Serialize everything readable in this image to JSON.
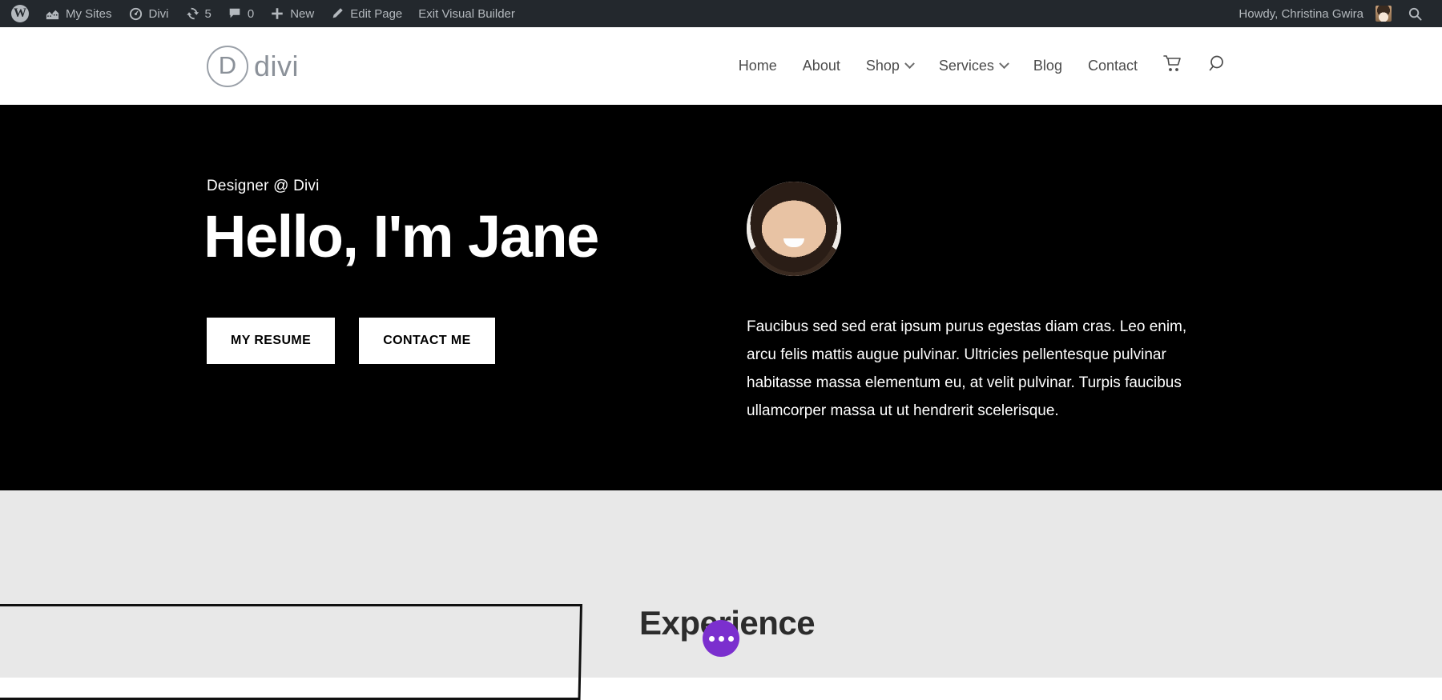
{
  "adminbar": {
    "wp_logo": "wordpress-logo-icon",
    "items": [
      {
        "label": "My Sites",
        "icon": "sites-icon"
      },
      {
        "label": "Divi",
        "icon": "divi-speedometer-icon"
      },
      {
        "label": "5",
        "icon": "updates-icon"
      },
      {
        "label": "0",
        "icon": "comments-icon"
      },
      {
        "label": "New",
        "icon": "plus-icon"
      },
      {
        "label": "Edit Page",
        "icon": "pencil-icon"
      },
      {
        "label": "Exit Visual Builder",
        "icon": "none"
      }
    ],
    "howdy": "Howdy, Christina Gwira",
    "search_icon": "search-icon"
  },
  "header": {
    "logo_letter": "D",
    "logo_word": "divi",
    "nav": [
      {
        "label": "Home",
        "has_caret": false
      },
      {
        "label": "About",
        "has_caret": false
      },
      {
        "label": "Shop",
        "has_caret": true
      },
      {
        "label": "Services",
        "has_caret": true
      },
      {
        "label": "Blog",
        "has_caret": false
      },
      {
        "label": "Contact",
        "has_caret": false
      }
    ],
    "cart_icon": "shopping-cart-icon",
    "search_icon": "search-icon"
  },
  "hero": {
    "eyebrow": "Designer @ Divi",
    "title": "Hello, I'm Jane",
    "buttons": [
      {
        "label": "MY RESUME"
      },
      {
        "label": "CONTACT ME"
      }
    ],
    "portrait_alt": "profile-photo",
    "paragraph": "Faucibus sed sed erat ipsum purus egestas diam cras. Leo enim, arcu felis mattis augue pulvinar. Ultricies pellentesque pulvinar habitasse massa elementum eu, at velit pulvinar. Turpis faucibus ullamcorper massa ut ut hendrerit scelerisque.",
    "background_color": "#000000",
    "text_color": "#ffffff"
  },
  "lower": {
    "heading": "Experience",
    "background_color": "#e8e8e8",
    "outline_color": "#101010",
    "fab_color": "#7b2fce",
    "fab_icon": "ellipsis-icon"
  }
}
